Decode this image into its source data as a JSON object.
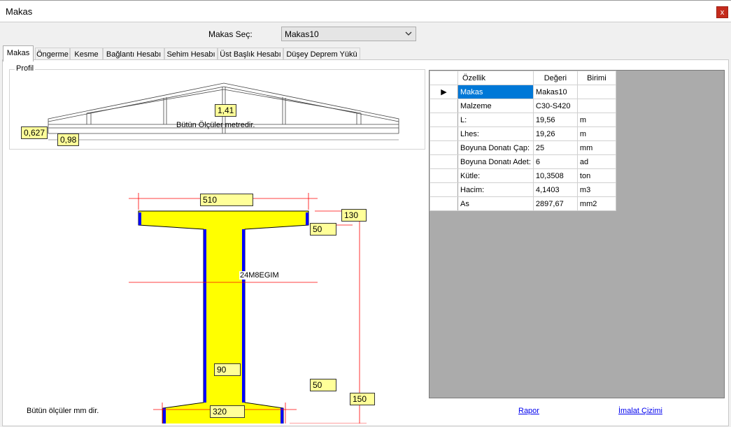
{
  "window": {
    "title": "Makas",
    "close_glyph": "x"
  },
  "selector": {
    "label": "Makas Seç:",
    "value": "Makas10"
  },
  "tabs": [
    {
      "label": "Makas"
    },
    {
      "label": "Öngerme"
    },
    {
      "label": "Kesme"
    },
    {
      "label": "Bağlantı Hesabı"
    },
    {
      "label": "Sehim Hesabı"
    },
    {
      "label": "Üst Başlık Hesabı"
    },
    {
      "label": "Düşey Deprem Yükü"
    }
  ],
  "profile": {
    "group_label": "Profil",
    "dim_left": "0,627",
    "dim_bottom": "0,98",
    "dim_top": "1,41",
    "note": "Bütün Ölçüler metredir."
  },
  "section": {
    "top_width": "510",
    "top_height": "130",
    "top_taper": "50",
    "web": "90",
    "bottom_taper": "50",
    "bottom_height": "150",
    "bottom_width": "320",
    "name": "24M8EGIM",
    "note": "Bütün ölçüler mm dir.",
    "fill_color": "#ffff00",
    "edge_color": "#0000ff",
    "dim_color": "#ff0000"
  },
  "grid": {
    "headers": [
      "Özellik",
      "Değeri",
      "Birimi"
    ],
    "rows": [
      {
        "name": "Makas",
        "value": "Makas10",
        "unit": ""
      },
      {
        "name": "Malzeme",
        "value": "C30-S420",
        "unit": ""
      },
      {
        "name": "L:",
        "value": "19,56",
        "unit": "m"
      },
      {
        "name": "Lhes:",
        "value": "19,26",
        "unit": "m"
      },
      {
        "name": "Boyuna Donatı Çap:",
        "value": "25",
        "unit": "mm"
      },
      {
        "name": "Boyuna Donatı Adet:",
        "value": "6",
        "unit": "ad"
      },
      {
        "name": "Kütle:",
        "value": "10,3508",
        "unit": "ton"
      },
      {
        "name": "Hacim:",
        "value": "4,1403",
        "unit": "m3"
      },
      {
        "name": "As",
        "value": "2897,67",
        "unit": "mm2"
      }
    ]
  },
  "links": {
    "report": "Rapor",
    "drawing": "İmalat Çizimi"
  }
}
